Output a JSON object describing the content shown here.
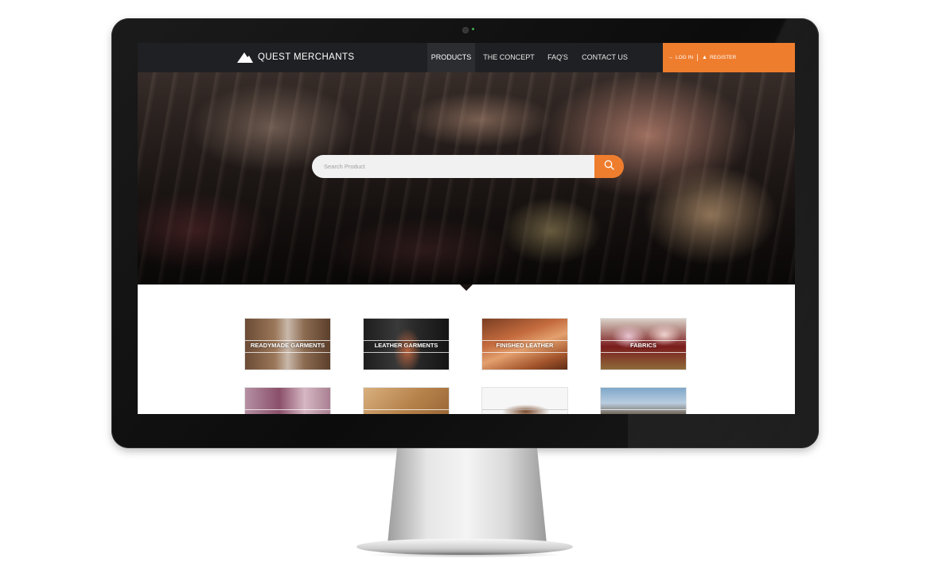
{
  "site": {
    "brand": "QUEST MERCHANTS"
  },
  "nav": {
    "items": [
      {
        "label": "PRODUCTS",
        "active": true
      },
      {
        "label": "THE CONCEPT",
        "active": false
      },
      {
        "label": "FAQ'S",
        "active": false
      },
      {
        "label": "CONTACT US",
        "active": false
      }
    ],
    "login_label": "LOG IN",
    "register_label": "REGISTER"
  },
  "hero": {
    "search_placeholder": "Search Product",
    "search_icon": "search-icon"
  },
  "products": [
    {
      "label": "READYMADE GARMENTS"
    },
    {
      "label": "LEATHER GARMENTS"
    },
    {
      "label": "FINISHED LEATHER"
    },
    {
      "label": "FABRICS"
    },
    {
      "label": ""
    },
    {
      "label": ""
    },
    {
      "label": ""
    },
    {
      "label": ""
    }
  ],
  "colors": {
    "accent": "#ee7d2e",
    "navbar": "#1f2023",
    "bezel": "#111111"
  }
}
